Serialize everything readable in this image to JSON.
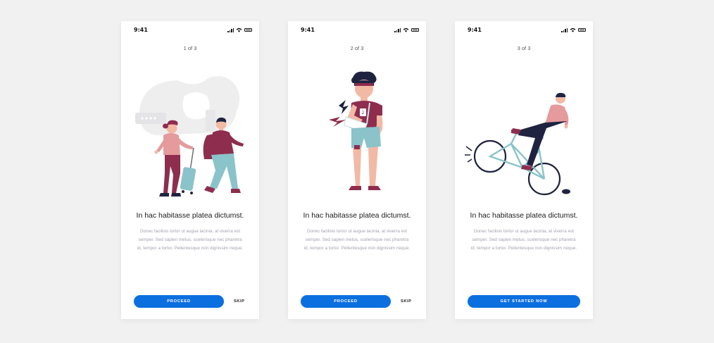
{
  "screens": [
    {
      "time": "9:41",
      "pager": "1 of 3",
      "headline": "In hac habitasse platea dictumst.",
      "body": "Donec facilisis tortor ut augue lacinia, at viverra est semper. Sed sapien metus, scelerisque nec pharetra id, tempor a tortor. Pellentesque non dignissim neque.",
      "primary_button": "PROCEED",
      "skip": "SKIP",
      "illustration": "travelers-with-luggage"
    },
    {
      "time": "9:41",
      "pager": "2 of 3",
      "headline": "In hac habitasse platea dictumst.",
      "body": "Donec facilisis tortor ut augue lacinia, at viverra est semper. Sed sapien metus, scelerisque nec pharetra id, tempor a tortor. Pellentesque non dignissim neque.",
      "primary_button": "PROCEED",
      "skip": "SKIP",
      "illustration": "injured-man-arm-sling"
    },
    {
      "time": "9:41",
      "pager": "3 of 3",
      "headline": "In hac habitasse platea dictumst.",
      "body": "Donec facilisis tortor ut augue lacinia, at viverra est semper. Sed sapien metus, scelerisque nec pharetra id, tempor a tortor. Pellentesque non dignissim neque.",
      "primary_button": "GET STARTED NOW",
      "illustration": "man-falling-off-bicycle"
    }
  ],
  "colors": {
    "background": "#f1f1f2",
    "screen": "#ffffff",
    "primary": "#0c6fe0",
    "maroon": "#8e2d4e",
    "pink": "#e59a9c",
    "skin": "#f2b9a5",
    "teal": "#8ac3c9",
    "navy": "#1f2340",
    "grey_bg": "#eeeeef"
  }
}
